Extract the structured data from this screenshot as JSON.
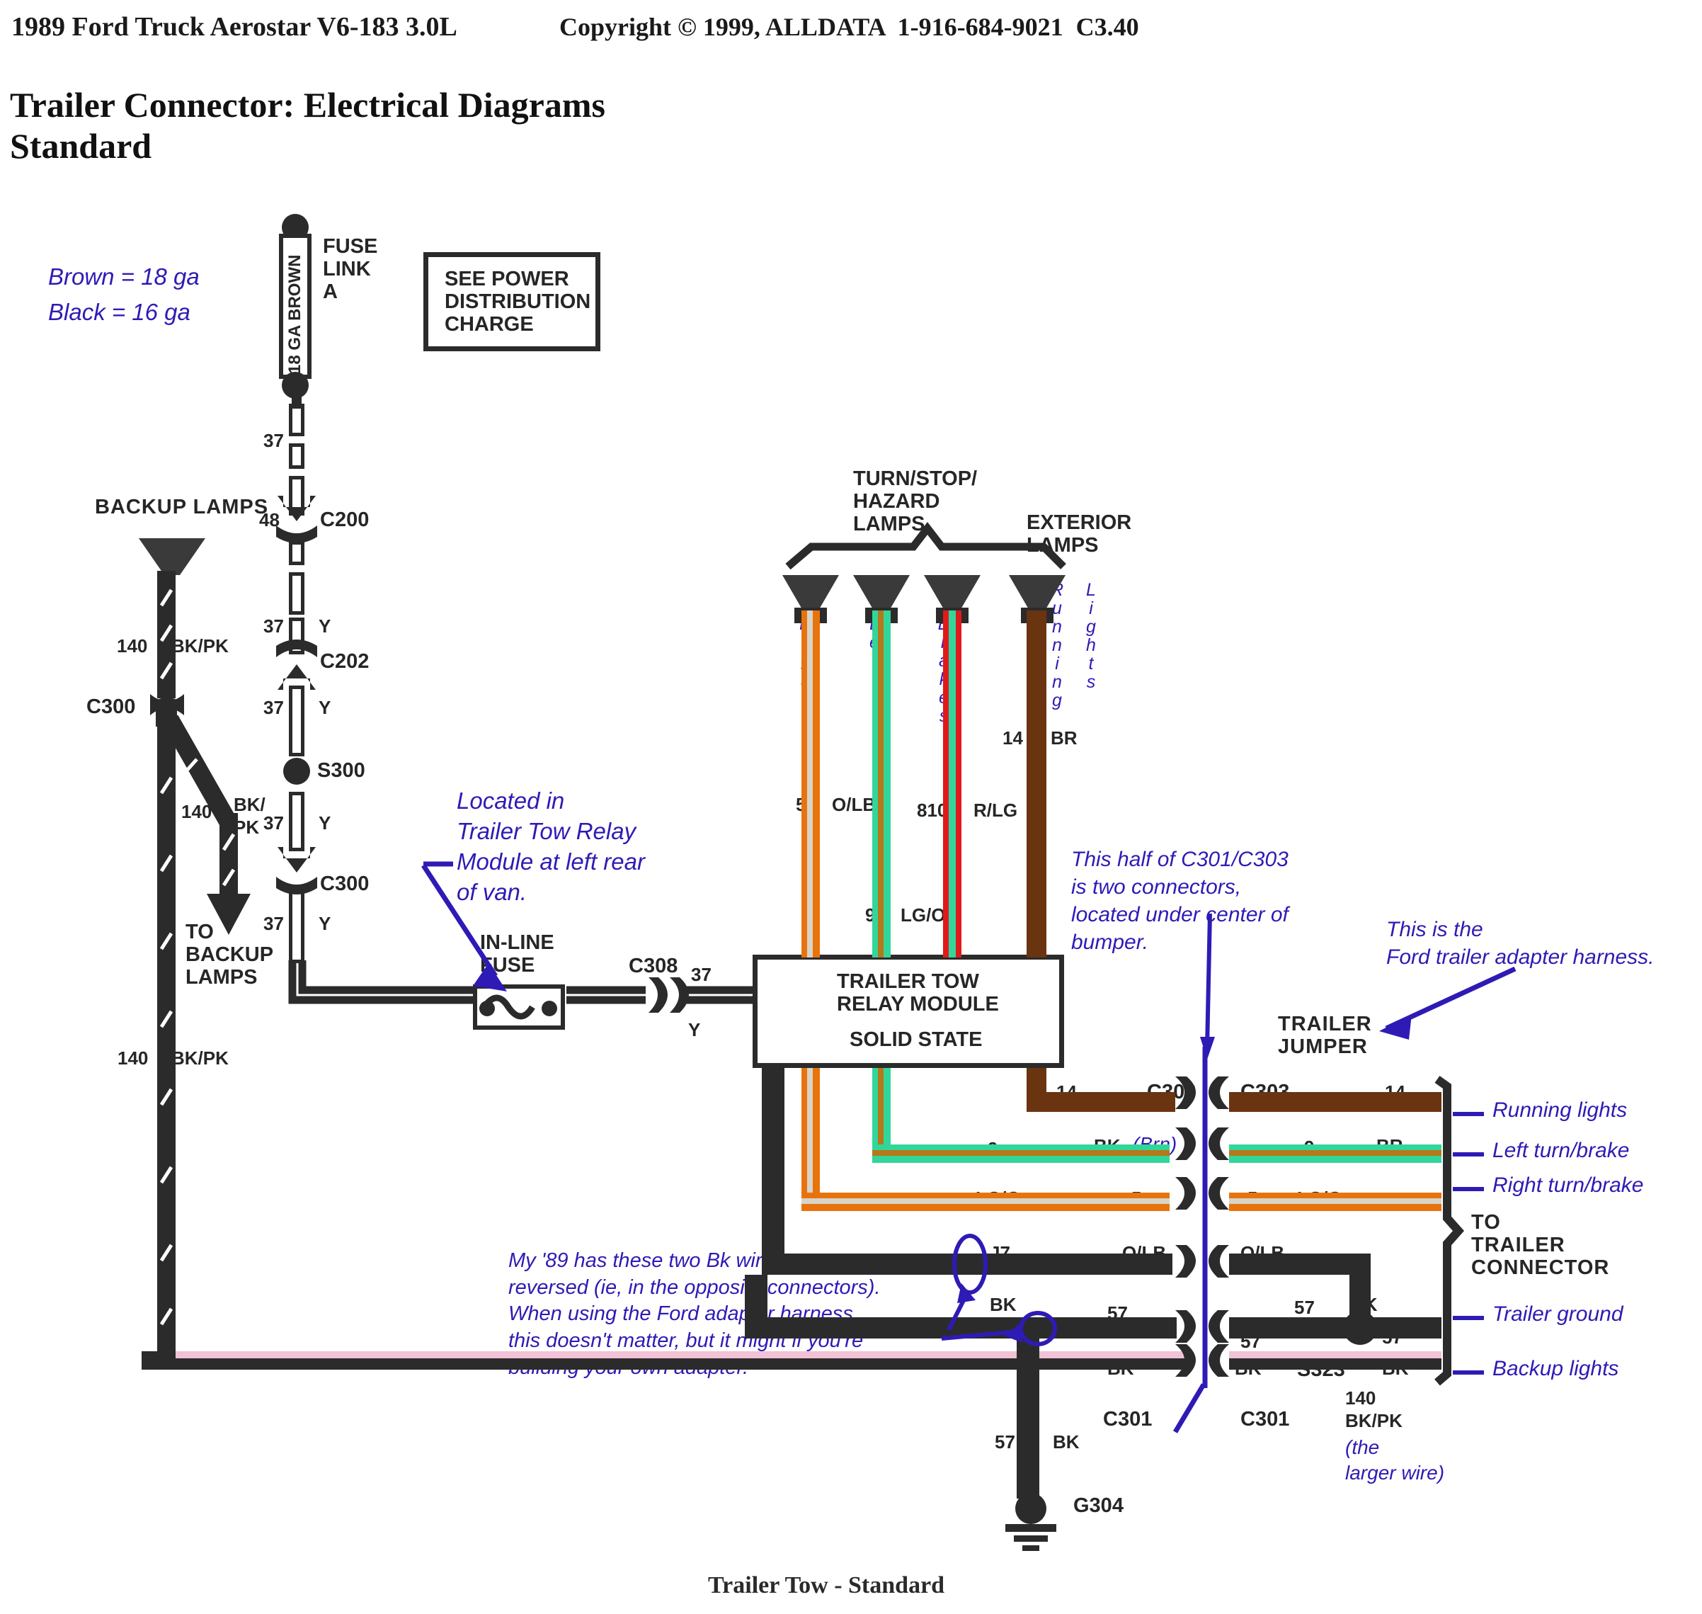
{
  "header": {
    "vehicle": "1989 Ford Truck Aerostar V6-183 3.0L",
    "copyright": "Copyright © 1999, ALLDATA  1-916-684-9021  C3.40"
  },
  "title": {
    "line1": "Trailer Connector: Electrical Diagrams",
    "line2": "Standard"
  },
  "footer": {
    "caption": "Trailer Tow - Standard"
  },
  "legend_gauge": {
    "line1": "Brown = 18 ga",
    "line2": "Black = 16 ga"
  },
  "fuse_link": {
    "vertical_label": "18 GA BROWN",
    "name_line1": "FUSE",
    "name_line2": "LINK",
    "name_line3": "A"
  },
  "power_box": {
    "line1": "SEE POWER",
    "line2": "DISTRIBUTION",
    "line3": "CHARGE"
  },
  "backup": {
    "title": "BACKUP LAMPS",
    "circ_140": "140",
    "color_bkpk": "BK/PK",
    "conn_c300": "C300",
    "circ_140b": "140",
    "color_bk_pk_2line_a": "BK/",
    "color_bk_pk_2line_b": "PK",
    "to_backup_1": "TO",
    "to_backup_2": "BACKUP",
    "to_backup_3": "LAMPS",
    "circ_140c": "140",
    "color_bkpk_c": "BK/PK"
  },
  "feed_chain": {
    "c37_a": "37",
    "c48": "48",
    "conn_c200": "C200",
    "c37_b": "37",
    "color_y_b": "Y",
    "conn_c202": "C202",
    "c37_c": "37",
    "color_y_c": "Y",
    "splice_s300": "S300",
    "c37_d": "37",
    "color_y_d": "Y",
    "conn_c300": "C300",
    "c37_e": "37",
    "color_y_e": "Y",
    "inline_fuse_1": "IN-LINE",
    "inline_fuse_2": "FUSE",
    "conn_c308": "C308",
    "c37_f": "37",
    "color_y_f": "Y"
  },
  "notes": {
    "relay_location": "Located in\nTrailer Tow Relay\nModule at left rear\nof van.",
    "c301_c303": "This half of C301/C303\nis two connectors,\nlocated under center of\nbumper.",
    "adapter_harness": "This is the\nFord trailer adapter harness.",
    "bk_reversed": "My '89 has these two Bk wires\nreversed (ie, in the opposite connectors).\nWhen using the Ford adapter harness,\nthis doesn't matter, but it might if you're\nbuilding your own adapter.",
    "bk_brn_strike": "BK",
    "bk_brn_paren": "(Brn)",
    "larger_wire": "(the\nlarger wire)"
  },
  "lamps": {
    "turnstop_1": "TURN/STOP/",
    "turnstop_2": "HAZARD",
    "turnstop_3": "LAMPS",
    "exterior_1": "EXTERIOR",
    "exterior_2": "LAMPS",
    "right": "Right",
    "left": "Left",
    "brakes": "Brakes",
    "running": "Running",
    "lights": "Lights"
  },
  "wire_labels": {
    "right_circ": "5",
    "right_color": "O/LB",
    "left_circ": "9",
    "left_color": "LG/O",
    "brake_circ": "810",
    "brake_color": "R/LG",
    "running_circ": "14",
    "running_color": "BR"
  },
  "relay_module": {
    "line1": "TRAILER TOW",
    "line2": "RELAY MODULE",
    "line3": "SOLID STATE"
  },
  "jumper": {
    "line1": "TRAILER",
    "line2": "JUMPER"
  },
  "connector_left": {
    "c14": "14",
    "name_c303": "C303",
    "c9": "9",
    "c5": "5",
    "color_lgo": "LG/O",
    "j7": "J7",
    "color_olb": "O/LB",
    "color_bk": "BK",
    "c57": "57",
    "color_bk2": "BK",
    "name_c301": "C301"
  },
  "connector_right": {
    "name_c303": "C303",
    "c14": "14",
    "color_br": "BR",
    "c9": "9",
    "c5": "5",
    "color_lgo": "LG/O",
    "color_olb": "O/LB",
    "c57_top": "57",
    "color_bk_top": "BK",
    "c57_left": "57",
    "splice_s323": "S323",
    "c57_right": "57",
    "color_bk_left": "BK",
    "color_bk_right": "BK",
    "name_c301": "C301",
    "c140": "140",
    "color_bkpk": "BK/PK"
  },
  "ground": {
    "circ_57": "57",
    "color_bk": "BK",
    "name": "G304"
  },
  "trailer_legend": {
    "to_trailer_1": "TO",
    "to_trailer_2": "TRAILER",
    "to_trailer_3": "CONNECTOR",
    "items": [
      "Running lights",
      "Left turn/brake",
      "Right turn/brake",
      "Trailer ground",
      "Backup lights"
    ]
  },
  "colors": {
    "ink": "#2b2b2b",
    "annotation": "#2e1bb5",
    "orange": "#e8730d",
    "orange_stripe": "#d8d4c8",
    "green": "#32d69a",
    "green_stripe": "#b5781a",
    "red": "#e2191b",
    "brown": "#6b3410",
    "pink": "#f2c2d6"
  }
}
